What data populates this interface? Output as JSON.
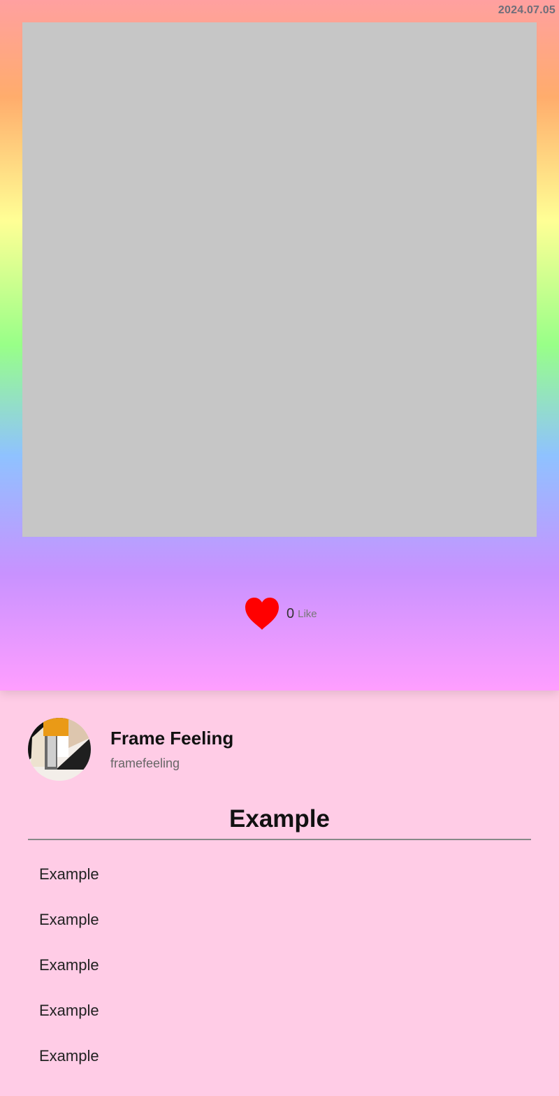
{
  "post": {
    "date": "2024.07.05",
    "likes": {
      "count": "0",
      "label": "Like",
      "icon": "heart-icon",
      "color": "#ff0000"
    }
  },
  "profile": {
    "name": "Frame Feeling",
    "handle": "framefeeling"
  },
  "section": {
    "title": "Example",
    "items": [
      "Example",
      "Example",
      "Example",
      "Example",
      "Example"
    ]
  }
}
